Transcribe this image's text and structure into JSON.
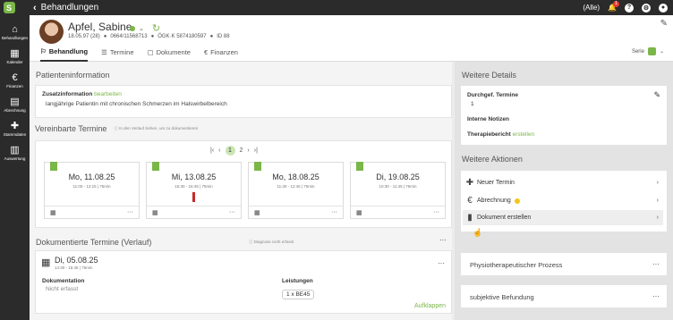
{
  "topbar": {
    "title": "Behandlungen",
    "filter": "(Alle)",
    "notif_count": "1"
  },
  "sidebar": [
    {
      "label": "Behandlungen",
      "icon": "home-icon",
      "glyph": "⌂"
    },
    {
      "label": "Kalender",
      "icon": "calendar-icon",
      "glyph": "▦"
    },
    {
      "label": "Finanzen",
      "icon": "euro-icon",
      "glyph": "€"
    },
    {
      "label": "Abrechnung",
      "icon": "document-icon",
      "glyph": "▤"
    },
    {
      "label": "Stammdaten",
      "icon": "puzzle-icon",
      "glyph": "✚"
    },
    {
      "label": "Auswertung",
      "icon": "chart-icon",
      "glyph": "▥"
    }
  ],
  "patient": {
    "name": "Apfel, Sabine",
    "status_caret": "⌄",
    "birth": "18.05.97 (28)",
    "phone": "0664/11568713",
    "insurance": "ÖGK·K 5874180597",
    "id": "ID 88"
  },
  "tabs": [
    {
      "label": "Behandlung",
      "icon": "⚐"
    },
    {
      "label": "Termine",
      "icon": "☰"
    },
    {
      "label": "Dokumente",
      "icon": "▢"
    },
    {
      "label": "Finanzen",
      "icon": "€"
    }
  ],
  "serie_label": "Serie",
  "patienteninfo": {
    "title": "Patienteninformation",
    "zusatz_label": "Zusatzinformation",
    "edit_link": "bearbeiten",
    "text": "langjährige Patientin mit chronischen Schmerzen im Halswirbelbereich"
  },
  "vereinbarte": {
    "title": "Vereinbarte Termine",
    "hint": "In den Verlauf ziehen, um zu dokumentieren",
    "pagination": {
      "current": "1",
      "next": "2"
    },
    "appointments": [
      {
        "day": "Mo, 11.08.25",
        "time": "11:00 - 12:15 | 75min"
      },
      {
        "day": "Mi, 13.08.25",
        "time": "15:30 - 16:45 | 75min"
      },
      {
        "day": "Mo, 18.08.25",
        "time": "11:30 - 12:45 | 75min"
      },
      {
        "day": "Di, 19.08.25",
        "time": "10:30 - 11:45 | 75min"
      }
    ]
  },
  "dokumentierte": {
    "title": "Dokumentierte Termine (Verlauf)",
    "hint": "Diagnose nicht erfasst",
    "date": "Di, 05.08.25",
    "time": "14:30 - 15:45 | 75min",
    "doc_label": "Dokumentation",
    "doc_value": "Nicht erfasst",
    "leist_label": "Leistungen",
    "leist_value": "1 x BE45",
    "expand": "Aufklappen"
  },
  "details": {
    "title": "Weitere Details",
    "durchgef_label": "Durchgef. Termine",
    "durchgef_value": "1",
    "notizen_label": "Interne Notizen",
    "therapie_label": "Therapiebericht",
    "therapie_link": "erstellen"
  },
  "aktionen": {
    "title": "Weitere Aktionen",
    "items": [
      "Neuer Termin",
      "Abrechnung",
      "Dokument erstellen"
    ]
  },
  "collapsed": [
    "Physiotherapeutischer Prozess",
    "subjektive Befundung"
  ],
  "more": "···"
}
